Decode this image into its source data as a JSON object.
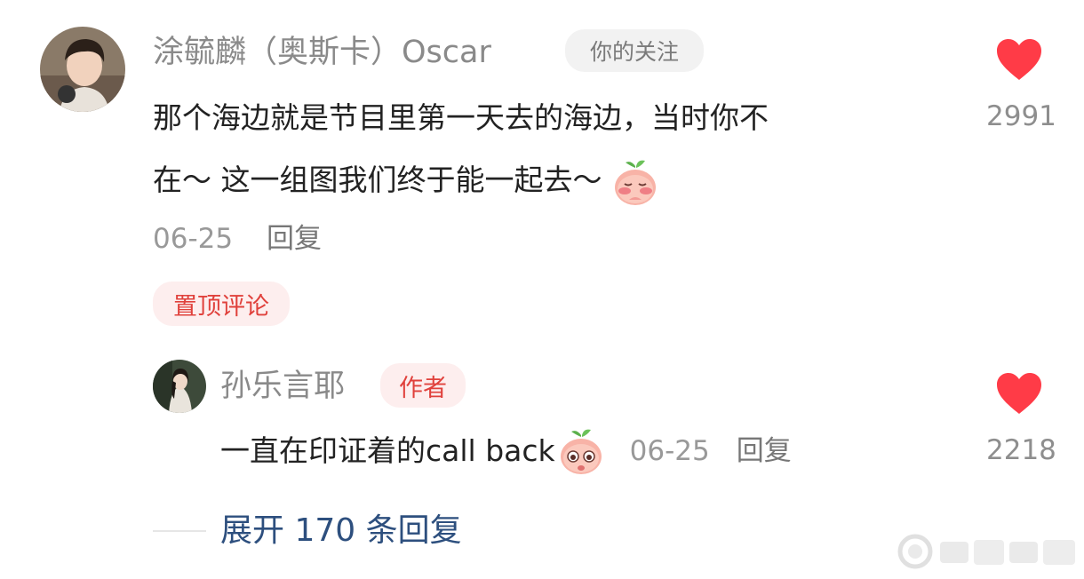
{
  "comment": {
    "author": "涂毓麟（奥斯卡）Oscar",
    "follow_badge": "你的关注",
    "text_line1": "那个海边就是节目里第一天去的海边，当时你不",
    "text_line2": "在～ 这一组图我们终于能一起去～",
    "date": "06-25",
    "reply_label": "回复",
    "pinned_label": "置顶评论",
    "likes": "2991"
  },
  "reply": {
    "author": "孙乐言耶",
    "author_badge": "作者",
    "text": "一直在印证着的call back",
    "date": "06-25",
    "reply_label": "回复",
    "likes": "2218"
  },
  "expand": {
    "label": "展开 170 条回复"
  },
  "colors": {
    "heart": "#ff3b47",
    "expand_link": "#2d4f7e",
    "pinned_text": "#e0413c"
  },
  "icons": {
    "like": "heart-icon",
    "emoji": "peach-emoji-icon",
    "watermark": "weibo-watermark"
  }
}
